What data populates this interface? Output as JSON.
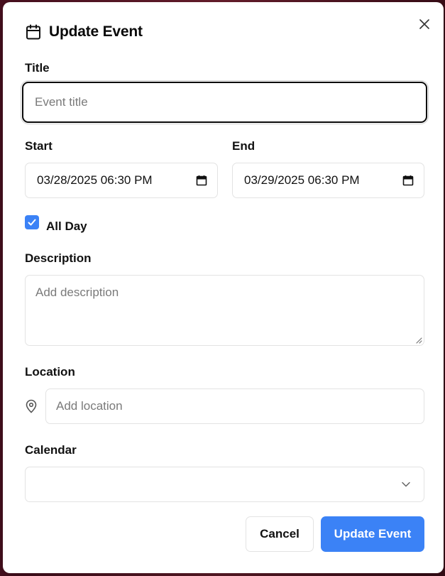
{
  "dialog": {
    "title": "Update Event",
    "title_icon": "calendar-icon",
    "close_icon": "close-icon"
  },
  "fields": {
    "title": {
      "label": "Title",
      "value": "",
      "placeholder": "Event title"
    },
    "start": {
      "label": "Start",
      "value": "03/28/2025 06:30 PM",
      "icon": "calendar-icon"
    },
    "end": {
      "label": "End",
      "value": "03/29/2025 06:30 PM",
      "icon": "calendar-icon"
    },
    "all_day": {
      "label": "All Day",
      "checked": true
    },
    "description": {
      "label": "Description",
      "value": "",
      "placeholder": "Add description"
    },
    "location": {
      "label": "Location",
      "value": "",
      "placeholder": "Add location",
      "icon": "map-pin-icon"
    },
    "calendar": {
      "label": "Calendar",
      "value": "",
      "icon": "chevron-down-icon"
    }
  },
  "actions": {
    "cancel_label": "Cancel",
    "submit_label": "Update Event"
  },
  "colors": {
    "accent": "#3b82f6",
    "border": "#e3e3e3",
    "focus_border": "#0a0a0a"
  }
}
